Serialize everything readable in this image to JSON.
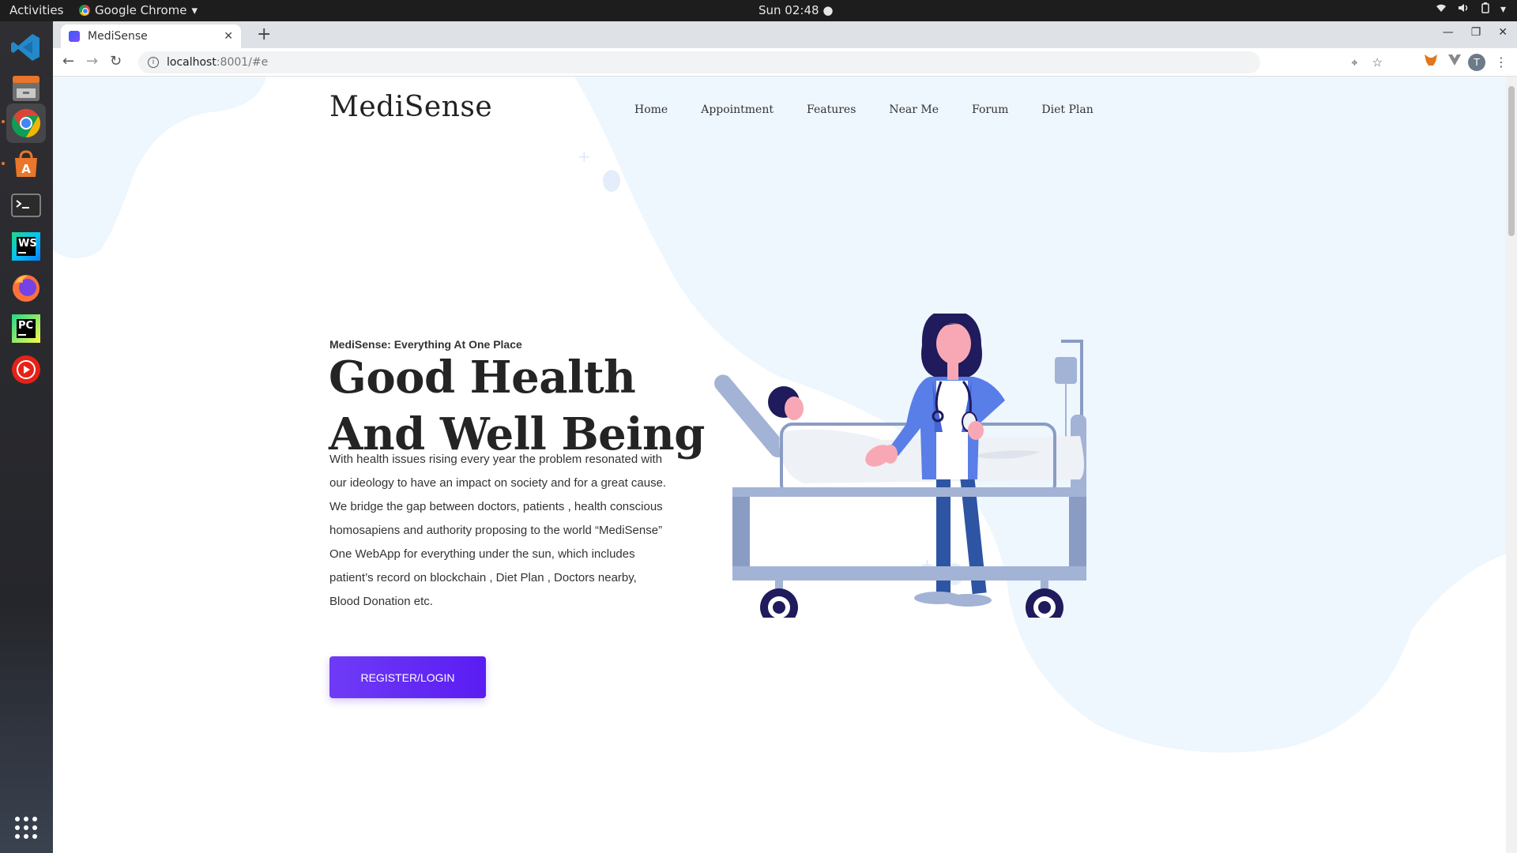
{
  "os": {
    "activities": "Activities",
    "app_name": "Google Chrome",
    "clock": "Sun 02:48"
  },
  "dock": {
    "items": [
      "vscode-icon",
      "files-icon",
      "chrome-icon",
      "software-icon",
      "terminal-icon",
      "webstorm-icon",
      "firefox-icon",
      "pycharm-icon",
      "youtube-music-icon",
      "app-grid-icon"
    ],
    "webstorm_label": "WS",
    "pycharm_label": "PC"
  },
  "browser": {
    "tab_title": "MediSense",
    "url_host": "localhost",
    "url_rest": ":8001/#e",
    "profile_initial": "T"
  },
  "site": {
    "brand": "MediSense",
    "nav": [
      "Home",
      "Appointment",
      "Features",
      "Near Me",
      "Forum",
      "Diet Plan"
    ],
    "eyebrow": "MediSense: Everything At One Place",
    "headline_line1": "Good Health",
    "headline_line2": "And Well Being",
    "body": "With health issues rising every year the problem resonated with our ideology to have an impact on society and for a great cause. We bridge the gap between doctors, patients , health conscious homosapiens and authority proposing to the world “MediSense” One WebApp for everything under the sun, which includes patient’s record on blockchain , Diet Plan , Doctors nearby, Blood Donation etc.",
    "cta": "REGISTER/LOGIN"
  },
  "colors": {
    "accent": "#6f3bf6",
    "blob": "#eef6fe",
    "bed": "#a3b3d6",
    "wheel": "#1f1b5c"
  }
}
